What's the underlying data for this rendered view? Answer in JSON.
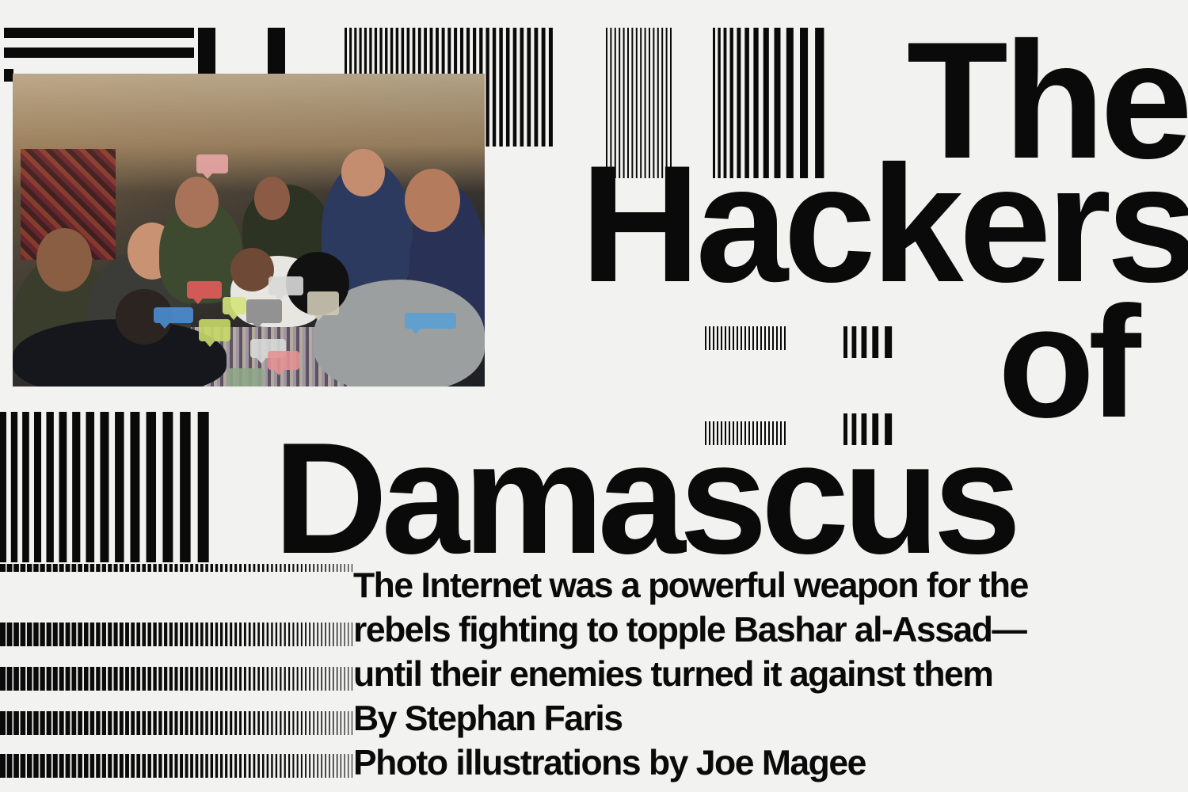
{
  "headline": {
    "word_1": "The",
    "word_2": "Hackers",
    "word_3": "of",
    "word_4": "Damascus"
  },
  "deck": {
    "line_1": "The Internet was a powerful weapon for the",
    "line_2": "rebels fighting to topple Bashar al-Assad—",
    "line_3": "until their enemies turned it against them"
  },
  "credits": {
    "byline": "By Stephan Faris",
    "photo_credit": "Photo illustrations by Joe Magee"
  },
  "colors": {
    "ink": "#0a0a0a",
    "paper": "#f2f2f0"
  }
}
